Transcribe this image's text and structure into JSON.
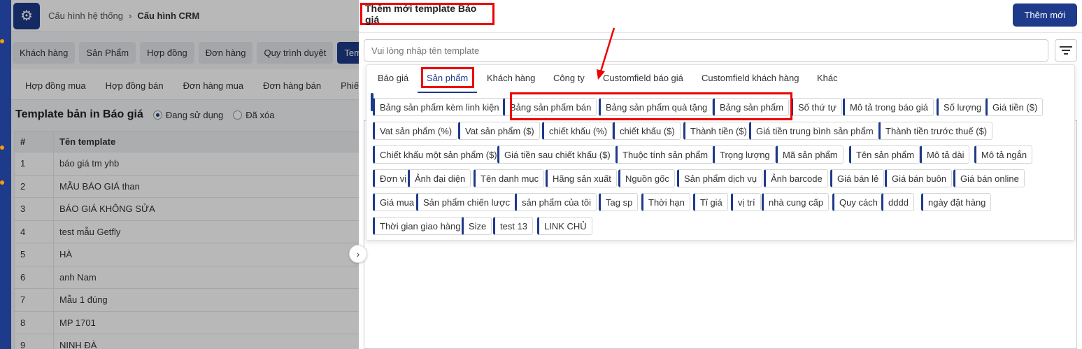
{
  "breadcrumb": {
    "parent": "Cấu hình hệ thống",
    "current": "Cấu hình CRM"
  },
  "main_tabs": [
    "Khách hàng",
    "Sản Phẩm",
    "Hợp đồng",
    "Đơn hàng",
    "Quy trình duyệt",
    "Templ"
  ],
  "sub_tabs": [
    "Hợp đồng mua",
    "Hợp đồng bán",
    "Đơn hàng mua",
    "Đơn hàng bán",
    "Phiếu th"
  ],
  "section": {
    "title": "Template bản in Báo giá",
    "radio_active": "Đang sử dụng",
    "radio_deleted": "Đã xóa"
  },
  "table": {
    "headers": [
      "#",
      "Tên template"
    ],
    "rows": [
      [
        "1",
        "báo giá tm yhb"
      ],
      [
        "2",
        "MẪU BÁO GIÁ than"
      ],
      [
        "3",
        "BÁO GIÁ KHÔNG SỬA"
      ],
      [
        "4",
        "test mẫu Getfly"
      ],
      [
        "5",
        "HÀ"
      ],
      [
        "6",
        "anh Nam"
      ],
      [
        "7",
        "Mẫu 1 đúng"
      ],
      [
        "8",
        "MP 1701"
      ],
      [
        "9",
        "NINH ĐÀ"
      ]
    ]
  },
  "drawer": {
    "title": "Thêm mới template Báo giá",
    "add_button": "Thêm mới",
    "search_placeholder": "Vui lòng nhập tên template"
  },
  "panel_tabs": [
    "Báo giá",
    "Sản phẩm",
    "Khách hàng",
    "Công ty",
    "Customfield báo giá",
    "Customfield khách hàng",
    "Khác"
  ],
  "active_panel_tab": "Sản phẩm",
  "chip_rows": [
    [
      "Bảng sản phẩm kèm linh kiện",
      "Bảng sản phẩm bán",
      "Bảng sản phẩm quà tặng",
      "Bảng sản phẩm",
      "Số thứ tự",
      "Mô tả trong báo giá",
      "Số lượng",
      "Giá tiền ($)"
    ],
    [
      "Vat sản phẩm (%)",
      "Vat sản phẩm ($)",
      "chiết khấu (%)",
      "chiết khấu ($)",
      "Thành tiền ($)",
      "Giá tiền trung bình sản phẩm",
      "Thành tiền trước thuế ($)"
    ],
    [
      "Chiết khấu một sản phẩm ($)",
      "Giá tiền sau chiết khấu ($)",
      "Thuộc tính sản phẩm",
      "Trọng lượng",
      "Mã sản phẩm",
      "Tên sản phẩm",
      "Mô tả dài",
      "Mô tả ngắn"
    ],
    [
      "Đơn vị",
      "Ảnh đại diện",
      "Tên danh mục",
      "Hãng sản xuất",
      "Nguồn gốc",
      "Sản phẩm dịch vụ",
      "Ảnh barcode",
      "Giá bán lẻ",
      "Giá bán buôn",
      "Giá bán online"
    ],
    [
      "Giá mua",
      "Sản phẩm chiến lược",
      "sản phẩm của tôi",
      "Tag sp",
      "Thời hạn",
      "Tỉ giá",
      "vị trí",
      "nhà cung cấp",
      "Quy cách",
      "dddd",
      "ngày đặt hàng"
    ],
    [
      "Thời gian giao hàng",
      "Size",
      "test 13",
      "LINK CHỦ"
    ]
  ],
  "colors": {
    "brand": "#1e3a8a",
    "highlight": "#e00000"
  },
  "icons": {
    "settings": "gear-icon",
    "filter": "filter-icon",
    "expand": "chevron-right-icon"
  }
}
